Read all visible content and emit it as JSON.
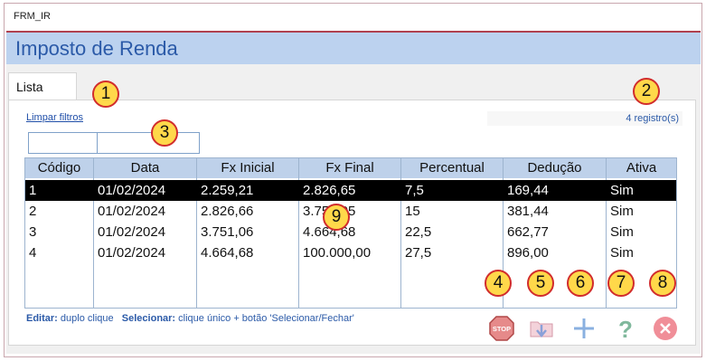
{
  "window": {
    "title": "FRM_IR"
  },
  "header": {
    "title": "Imposto de Renda"
  },
  "tabs": [
    {
      "label": "Lista"
    }
  ],
  "list": {
    "clear_filters": "Limpar filtros",
    "record_count": "4 registro(s)",
    "filters": [
      {
        "value": ""
      },
      {
        "value": ""
      }
    ],
    "columns": [
      "Código",
      "Data",
      "Fx Inicial",
      "Fx Final",
      "Percentual",
      "Dedução",
      "Ativa"
    ],
    "rows": [
      [
        "1",
        "01/02/2024",
        "2.259,21",
        "2.826,65",
        "7,5",
        "169,44",
        "Sim"
      ],
      [
        "2",
        "01/02/2024",
        "2.826,66",
        "3.751,05",
        "15",
        "381,44",
        "Sim"
      ],
      [
        "3",
        "01/02/2024",
        "3.751,06",
        "4.664,68",
        "22,5",
        "662,77",
        "Sim"
      ],
      [
        "4",
        "01/02/2024",
        "4.664,68",
        "100.000,00",
        "27,5",
        "896,00",
        "Sim"
      ]
    ],
    "selected_row": 0
  },
  "hint": {
    "edit_label": "Editar:",
    "edit_text": "duplo clique",
    "select_label": "Selecionar:",
    "select_text": "clique único + botão 'Selecionar/Fechar'"
  },
  "toolbar": [
    {
      "icon": "stop-icon",
      "label": "STOP"
    },
    {
      "icon": "select-close-icon"
    },
    {
      "icon": "add-icon"
    },
    {
      "icon": "help-icon"
    },
    {
      "icon": "close-icon"
    }
  ],
  "callouts": [
    "1",
    "2",
    "3",
    "4",
    "5",
    "6",
    "7",
    "8",
    "9"
  ]
}
